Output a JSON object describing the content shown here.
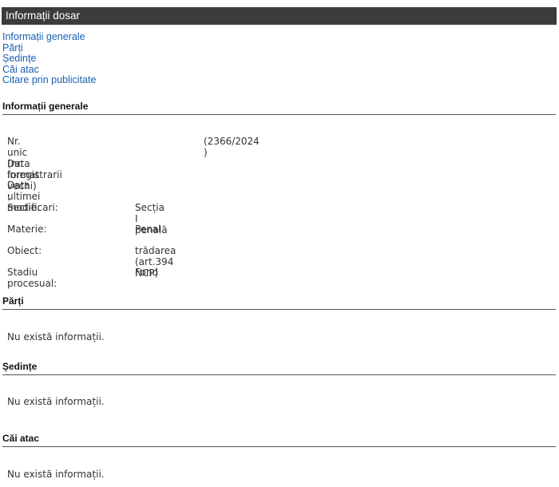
{
  "title": "Informații dosar",
  "nav": [
    "Informații generale",
    "Părți",
    "Ședințe",
    "Căi atac",
    "Citare prin publicitate"
  ],
  "general": {
    "heading": "Informații generale",
    "fields": [
      {
        "label": "Nr. unic (nr. format vechi) :",
        "value": "(2366/2024 )"
      },
      {
        "label": "Data inregistrarii",
        "value": ""
      },
      {
        "label": "Data ultimei modificari:",
        "value": ""
      },
      {
        "label": "Sectie:",
        "value": "Secția I penală"
      },
      {
        "label": "Materie:",
        "value": "Penal"
      },
      {
        "label": "Obiect:",
        "value": "trădarea (art.394 NCP)"
      },
      {
        "label": "Stadiu procesual:",
        "value": "Fond"
      }
    ]
  },
  "parti": {
    "heading": "Părți",
    "empty": "Nu există informații."
  },
  "sedinte": {
    "heading": "Ședințe",
    "empty": "Nu există informații."
  },
  "cai_atac": {
    "heading": "Căi atac",
    "empty": "Nu există informații."
  }
}
